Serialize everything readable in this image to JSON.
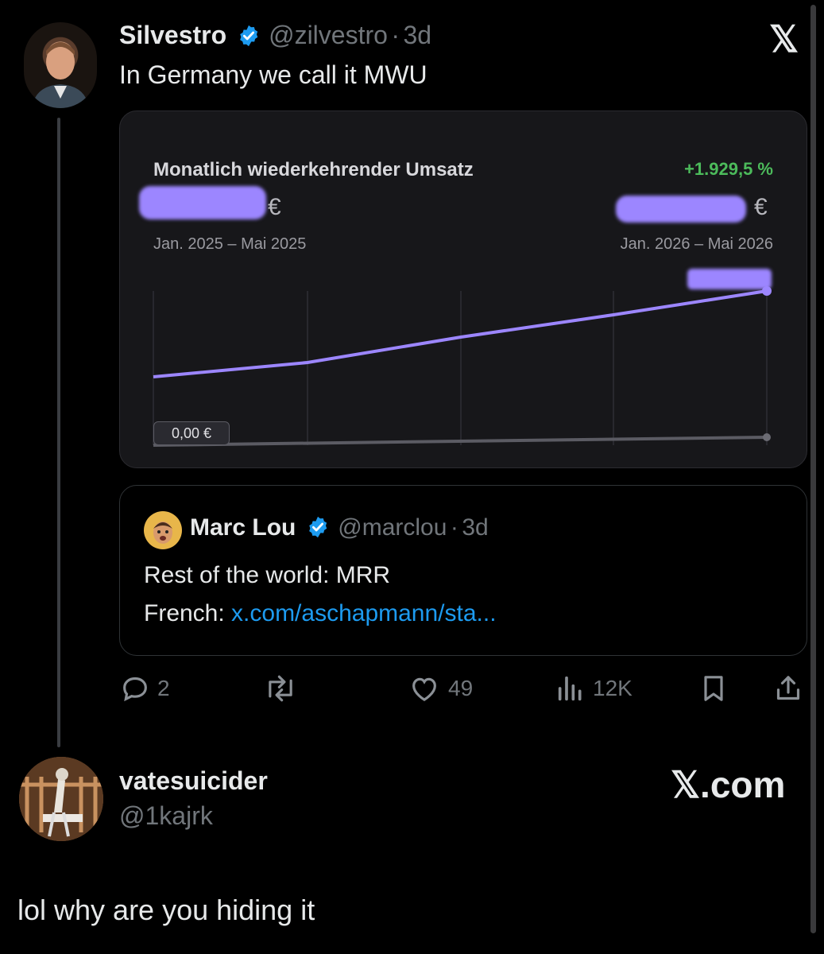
{
  "post": {
    "author_name": "Silvestro",
    "author_handle": "@zilvestro",
    "dot": "·",
    "age": "3d",
    "text": "In Germany we call it MWU",
    "close_label": "𝕏"
  },
  "chart_card": {
    "title": "Monatlich wiederkehrender Umsatz",
    "change": "+1.929,5 %",
    "left_currency": "€",
    "right_currency": "€",
    "left_range": "Jan. 2025 – Mai 2025",
    "right_range": "Jan. 2026 – Mai 2026",
    "zero_label": "0,00 €",
    "accent_color": "#9c86ff"
  },
  "quote": {
    "author_name": "Marc Lou",
    "author_handle": "@marclou",
    "dot": "·",
    "age": "3d",
    "line1": "Rest of the world: MRR",
    "line2_prefix": "French: ",
    "line2_link": "x.com/aschapmann/sta..."
  },
  "actions": {
    "replies": "2",
    "likes": "49",
    "views": "12K"
  },
  "reply": {
    "author_name": "vatesuicider",
    "author_handle": "@1kajrk",
    "brand": "𝕏.com",
    "text": "lol why are you hiding it"
  },
  "icons": [
    "verified-badge-icon",
    "x-logo-icon",
    "reply-icon",
    "repost-icon",
    "like-icon",
    "views-icon",
    "bookmark-icon",
    "share-icon"
  ]
}
